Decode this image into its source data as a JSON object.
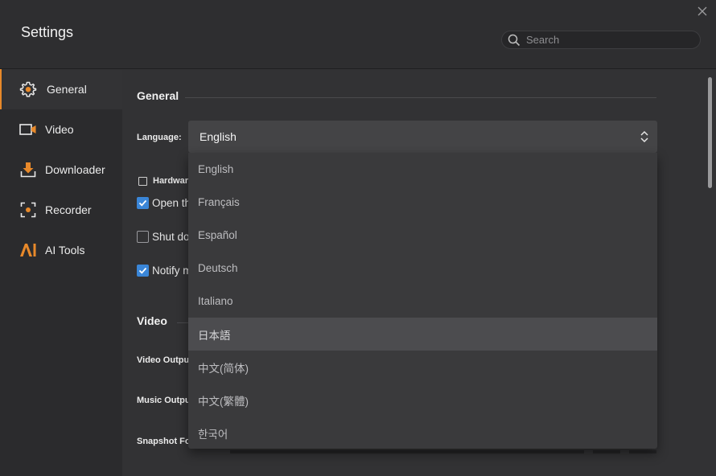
{
  "header": {
    "title": "Settings",
    "search_placeholder": "Search"
  },
  "sidebar": {
    "items": [
      {
        "label": "General",
        "icon": "gear-icon",
        "active": true
      },
      {
        "label": "Video",
        "icon": "video-icon",
        "active": false
      },
      {
        "label": "Downloader",
        "icon": "download-icon",
        "active": false
      },
      {
        "label": "Recorder",
        "icon": "record-icon",
        "active": false
      },
      {
        "label": "AI Tools",
        "icon": "ai-icon",
        "active": false
      }
    ]
  },
  "general": {
    "section_title": "General",
    "language_label": "Language:",
    "language_value": "English",
    "hardware_label": "Hardwar",
    "option1_label": "Open th",
    "option1_checked": true,
    "option2_label": "Shut do",
    "option2_checked": false,
    "option3_label": "Notify m",
    "option3_checked": true
  },
  "video": {
    "section_title": "Video",
    "video_output_label": "Video Output",
    "music_output_label": "Music Output",
    "snapshot_label": "Snapshot Fo"
  },
  "language_dropdown": {
    "options": [
      "English",
      "Français",
      "Español",
      "Deutsch",
      "Italiano",
      "日本語",
      "中文(简体)",
      "中文(繁體)",
      "한국어"
    ],
    "highlighted_index": 5
  },
  "colors": {
    "accent": "#e8892a",
    "checkbox": "#3a86d8",
    "background": "#2b2b2d",
    "content_bg": "#323234",
    "dropdown_bg": "#3a3a3c"
  }
}
